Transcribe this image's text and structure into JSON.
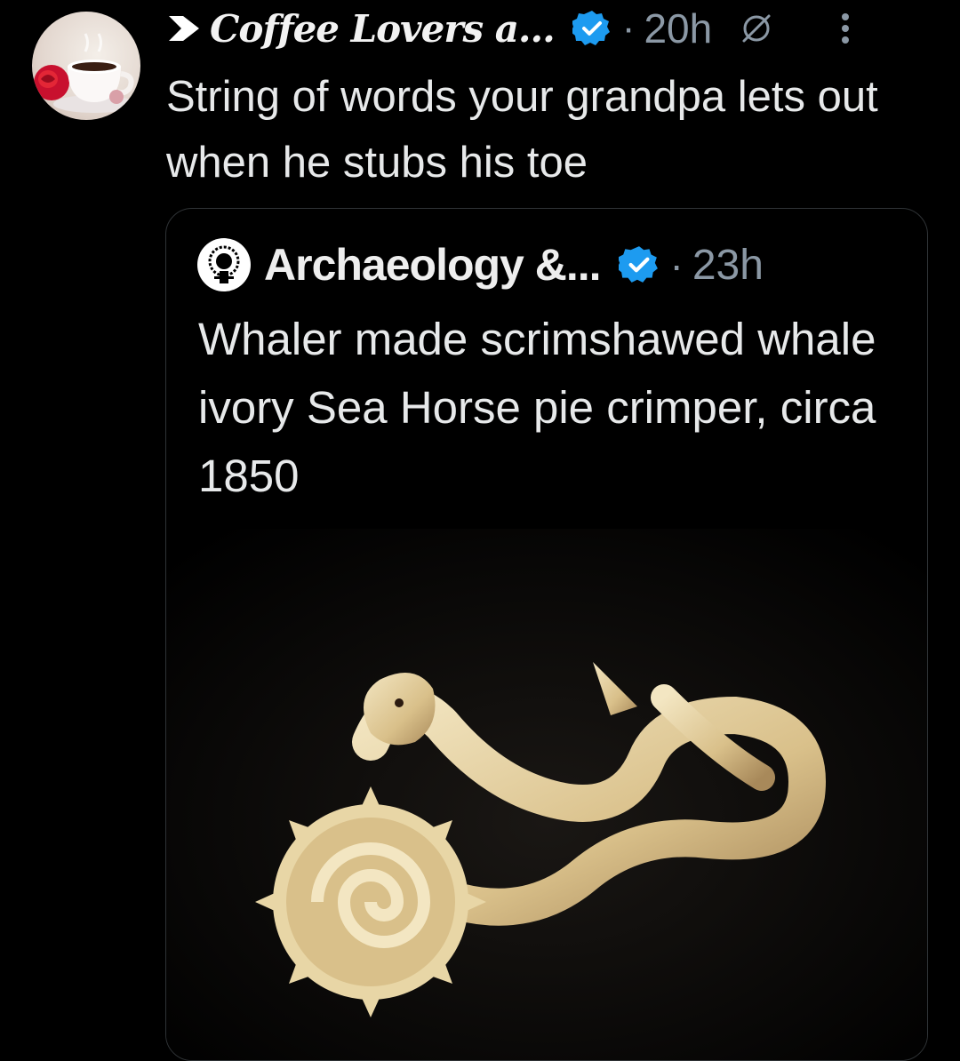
{
  "post": {
    "author_name": "Coffee Lovers a...",
    "time": "20h",
    "text": "String of words your grandpa lets out when he stubs his toe",
    "separator": "·"
  },
  "quoted_post": {
    "author_name": "Archaeology &...",
    "time": "23h",
    "text": "Whaler made scrimshawed whale ivory Sea Horse pie crimper, circa 1850",
    "separator": "·"
  },
  "icons": {
    "community": "play-arrow-icon",
    "verified": "verified-badge-icon",
    "grok": "slash-circle-icon",
    "more": "more-vertical-icon"
  },
  "colors": {
    "background": "#000000",
    "text": "#e7e9ea",
    "muted": "#8b98a5",
    "verified": "#1d9bf0",
    "card_border": "#2f3336"
  }
}
